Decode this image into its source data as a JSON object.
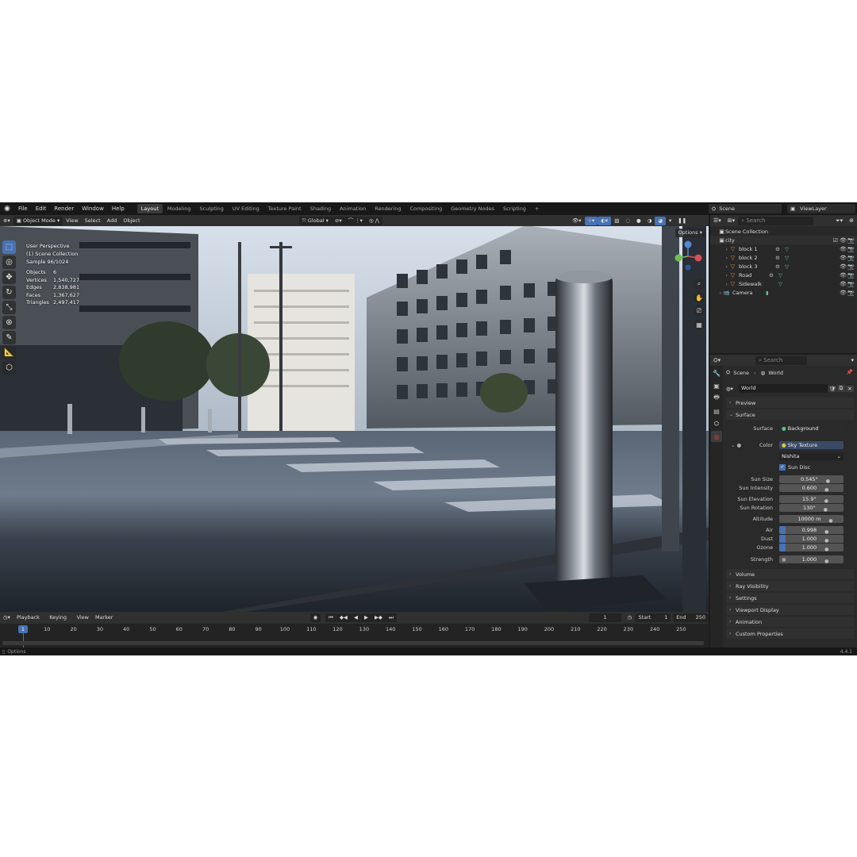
{
  "menu": [
    "File",
    "Edit",
    "Render",
    "Window",
    "Help"
  ],
  "workspaces": [
    "Layout",
    "Modeling",
    "Sculpting",
    "UV Editing",
    "Texture Paint",
    "Shading",
    "Animation",
    "Rendering",
    "Compositing",
    "Geometry Nodes",
    "Scripting",
    "+"
  ],
  "scene_name": "Scene",
  "view_layer": "ViewLayer",
  "viewport_header": {
    "mode": "Object Mode",
    "view": "View",
    "select": "Select",
    "add": "Add",
    "object": "Object",
    "orientation": "Global"
  },
  "viewport": {
    "perspective": "User Perspective",
    "collection": "(1) Scene Collection",
    "sample": "Sample 96/1024",
    "options_label": "Options",
    "stats": [
      {
        "label": "Objects",
        "value": "6"
      },
      {
        "label": "Vertices",
        "value": "1,540,727"
      },
      {
        "label": "Edges",
        "value": "2,838,981"
      },
      {
        "label": "Faces",
        "value": "1,367,627"
      },
      {
        "label": "Triangles",
        "value": "2,497,417"
      }
    ]
  },
  "timeline": {
    "playback": "Playback",
    "keying": "Keying",
    "view": "View",
    "marker": "Marker",
    "current_frame": "1",
    "start_label": "Start",
    "start": "1",
    "end_label": "End",
    "end": "250",
    "current_marker": "1",
    "ticks": [
      "10",
      "20",
      "30",
      "40",
      "50",
      "60",
      "70",
      "80",
      "90",
      "100",
      "110",
      "120",
      "130",
      "140",
      "150",
      "160",
      "170",
      "180",
      "190",
      "200",
      "210",
      "220",
      "230",
      "240",
      "250"
    ]
  },
  "status": {
    "left": "Options",
    "version": "4.4.1"
  },
  "outliner": {
    "search_placeholder": "Search",
    "root": "Scene Collection",
    "collection": "city",
    "items": [
      "block 1",
      "block 2",
      "block 3",
      "Road",
      "Sidewalk"
    ],
    "camera": "Camera"
  },
  "properties": {
    "search_placeholder": "Search",
    "breadcrumb_scene": "Scene",
    "breadcrumb_world": "World",
    "world_name": "World",
    "panels": {
      "preview": "Preview",
      "surface": "Surface",
      "volume": "Volume",
      "ray_visibility": "Ray Visibility",
      "settings": "Settings",
      "viewport_display": "Viewport Display",
      "animation": "Animation",
      "custom_properties": "Custom Properties"
    },
    "surface_label": "Surface",
    "surface_value": "Background",
    "color_label": "Color",
    "color_value": "Sky Texture",
    "sky_type": "Nishita",
    "sun_disc": "Sun Disc",
    "sun_size_label": "Sun Size",
    "sun_size": "0.545°",
    "sun_intensity_label": "Sun Intensity",
    "sun_intensity": "0.600",
    "sun_elevation_label": "Sun Elevation",
    "sun_elevation": "15.9°",
    "sun_rotation_label": "Sun Rotation",
    "sun_rotation": "130°",
    "altitude_label": "Altitude",
    "altitude": "10000 m",
    "air_label": "Air",
    "air": "0.998",
    "air_fill": 0.1,
    "dust_label": "Dust",
    "dust": "1.000",
    "dust_fill": 0.1,
    "ozone_label": "Ozone",
    "ozone": "1.000",
    "ozone_fill": 0.1,
    "strength_label": "Strength",
    "strength": "1.000"
  },
  "colors": {
    "accent": "#4772b3",
    "object_orange": "#e8903c",
    "mesh_green": "#5fc48a",
    "world_red": "#c43c3c"
  }
}
